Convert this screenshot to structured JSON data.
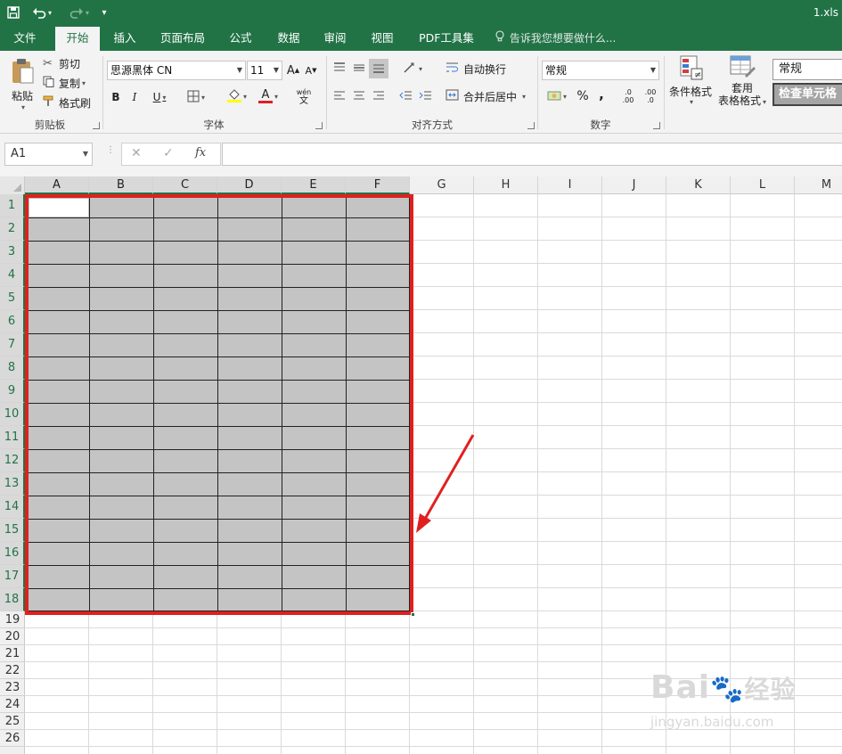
{
  "window": {
    "filename": "1.xls"
  },
  "quick_access": {
    "save_icon": "save-icon",
    "undo_icon": "undo-icon",
    "redo_icon": "redo-icon",
    "customize_icon": "customize-qat-icon"
  },
  "tabs": [
    {
      "label": "文件"
    },
    {
      "label": "开始"
    },
    {
      "label": "插入"
    },
    {
      "label": "页面布局"
    },
    {
      "label": "公式"
    },
    {
      "label": "数据"
    },
    {
      "label": "审阅"
    },
    {
      "label": "视图"
    },
    {
      "label": "PDF工具集"
    }
  ],
  "active_tab": "开始",
  "tell_me": {
    "placeholder": "告诉我您想要做什么..."
  },
  "ribbon": {
    "clipboard": {
      "paste": "粘贴",
      "cut": "剪切",
      "copy": "复制",
      "format_painter": "格式刷",
      "group": "剪贴板"
    },
    "font": {
      "name": "思源黑体 CN",
      "size": "11",
      "bold": "B",
      "italic": "I",
      "underline": "U",
      "grow": "A",
      "shrink": "A",
      "font_color": "A",
      "phonetic": "wén",
      "phonetic2": "文",
      "group": "字体"
    },
    "alignment": {
      "wrap": "自动换行",
      "merge": "合并后居中",
      "group": "对齐方式"
    },
    "number": {
      "format": "常规",
      "percent": "%",
      "comma": ",",
      "inc_dec": ".00",
      "dec_dec": ".0",
      "group": "数字"
    },
    "styles": {
      "conditional": "条件格式",
      "table_line1": "套用",
      "table_line2": "表格格式",
      "style_normal": "常规",
      "style_check": "检查单元格"
    }
  },
  "formula_bar": {
    "name_box": "A1",
    "fx": "fx",
    "cancel_icon": "cancel-icon",
    "enter_icon": "enter-icon",
    "value": ""
  },
  "columns": [
    "A",
    "B",
    "C",
    "D",
    "E",
    "F",
    "G",
    "H",
    "I",
    "J",
    "K",
    "L",
    "M"
  ],
  "rows": [
    "1",
    "2",
    "3",
    "4",
    "5",
    "6",
    "7",
    "8",
    "9",
    "10",
    "11",
    "12",
    "13",
    "14",
    "15",
    "16",
    "17",
    "18",
    "19",
    "20",
    "21",
    "22",
    "23",
    "24",
    "25",
    "26"
  ],
  "selection": {
    "range": "A1:F18",
    "fill_color": "#c4c4c4",
    "border_color": "#222222"
  },
  "annotation": {
    "box_color": "#e02020",
    "arrow_color": "#e02020"
  },
  "watermark": {
    "brand": "Bai",
    "brand_cn": "经验",
    "url": "jingyan.baidu.com"
  },
  "colors": {
    "excel_green": "#217346",
    "ribbon_bg": "#f3f3f3"
  }
}
